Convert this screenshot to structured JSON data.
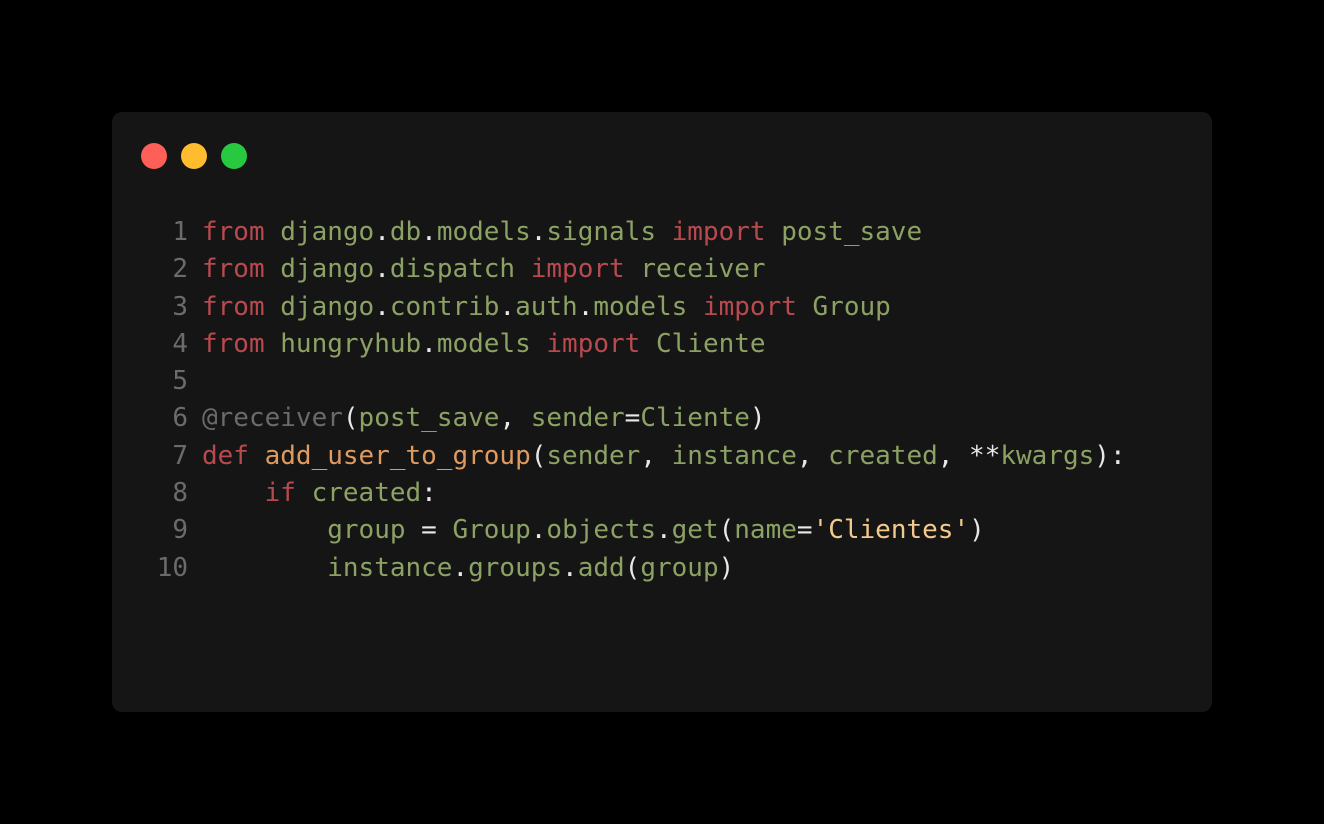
{
  "window": {
    "controls": [
      {
        "name": "close",
        "color": "#fe5f57"
      },
      {
        "name": "minimize",
        "color": "#febc2e"
      },
      {
        "name": "maximize",
        "color": "#28c840"
      }
    ]
  },
  "colors": {
    "keyword": "#b84a4f",
    "identifier": "#8ba264",
    "function": "#df9a5f",
    "string": "#f4c98c",
    "decorator": "#6a6a6a",
    "punctuation": "#e8e8e8",
    "line_number": "#6b6b6b",
    "background": "#151515"
  },
  "code": {
    "lines": [
      {
        "number": "1",
        "tokens": [
          {
            "t": "from",
            "k": "kw"
          },
          {
            "t": " ",
            "k": "op"
          },
          {
            "t": "django",
            "k": "id"
          },
          {
            "t": ".",
            "k": "op"
          },
          {
            "t": "db",
            "k": "id"
          },
          {
            "t": ".",
            "k": "op"
          },
          {
            "t": "models",
            "k": "id"
          },
          {
            "t": ".",
            "k": "op"
          },
          {
            "t": "signals",
            "k": "id"
          },
          {
            "t": " ",
            "k": "op"
          },
          {
            "t": "import",
            "k": "kw"
          },
          {
            "t": " ",
            "k": "op"
          },
          {
            "t": "post_save",
            "k": "id"
          }
        ]
      },
      {
        "number": "2",
        "tokens": [
          {
            "t": "from",
            "k": "kw"
          },
          {
            "t": " ",
            "k": "op"
          },
          {
            "t": "django",
            "k": "id"
          },
          {
            "t": ".",
            "k": "op"
          },
          {
            "t": "dispatch",
            "k": "id"
          },
          {
            "t": " ",
            "k": "op"
          },
          {
            "t": "import",
            "k": "kw"
          },
          {
            "t": " ",
            "k": "op"
          },
          {
            "t": "receiver",
            "k": "id"
          }
        ]
      },
      {
        "number": "3",
        "tokens": [
          {
            "t": "from",
            "k": "kw"
          },
          {
            "t": " ",
            "k": "op"
          },
          {
            "t": "django",
            "k": "id"
          },
          {
            "t": ".",
            "k": "op"
          },
          {
            "t": "contrib",
            "k": "id"
          },
          {
            "t": ".",
            "k": "op"
          },
          {
            "t": "auth",
            "k": "id"
          },
          {
            "t": ".",
            "k": "op"
          },
          {
            "t": "models",
            "k": "id"
          },
          {
            "t": " ",
            "k": "op"
          },
          {
            "t": "import",
            "k": "kw"
          },
          {
            "t": " ",
            "k": "op"
          },
          {
            "t": "Group",
            "k": "id"
          }
        ]
      },
      {
        "number": "4",
        "tokens": [
          {
            "t": "from",
            "k": "kw"
          },
          {
            "t": " ",
            "k": "op"
          },
          {
            "t": "hungryhub",
            "k": "id"
          },
          {
            "t": ".",
            "k": "op"
          },
          {
            "t": "models",
            "k": "id"
          },
          {
            "t": " ",
            "k": "op"
          },
          {
            "t": "import",
            "k": "kw"
          },
          {
            "t": " ",
            "k": "op"
          },
          {
            "t": "Cliente",
            "k": "id"
          }
        ]
      },
      {
        "number": "5",
        "tokens": []
      },
      {
        "number": "6",
        "tokens": [
          {
            "t": "@receiver",
            "k": "dec"
          },
          {
            "t": "(",
            "k": "op"
          },
          {
            "t": "post_save",
            "k": "id"
          },
          {
            "t": ", ",
            "k": "op"
          },
          {
            "t": "sender",
            "k": "id"
          },
          {
            "t": "=",
            "k": "op"
          },
          {
            "t": "Cliente",
            "k": "id"
          },
          {
            "t": ")",
            "k": "op"
          }
        ]
      },
      {
        "number": "7",
        "tokens": [
          {
            "t": "def",
            "k": "kw"
          },
          {
            "t": " ",
            "k": "op"
          },
          {
            "t": "add_user_to_group",
            "k": "fn"
          },
          {
            "t": "(",
            "k": "op"
          },
          {
            "t": "sender",
            "k": "id"
          },
          {
            "t": ", ",
            "k": "op"
          },
          {
            "t": "instance",
            "k": "id"
          },
          {
            "t": ", ",
            "k": "op"
          },
          {
            "t": "created",
            "k": "id"
          },
          {
            "t": ", **",
            "k": "op"
          },
          {
            "t": "kwargs",
            "k": "id"
          },
          {
            "t": "):",
            "k": "op"
          }
        ]
      },
      {
        "number": "8",
        "tokens": [
          {
            "t": "    ",
            "k": "op"
          },
          {
            "t": "if",
            "k": "kw"
          },
          {
            "t": " ",
            "k": "op"
          },
          {
            "t": "created",
            "k": "id"
          },
          {
            "t": ":",
            "k": "op"
          }
        ]
      },
      {
        "number": "9",
        "tokens": [
          {
            "t": "        ",
            "k": "op"
          },
          {
            "t": "group",
            "k": "id"
          },
          {
            "t": " = ",
            "k": "op"
          },
          {
            "t": "Group",
            "k": "id"
          },
          {
            "t": ".",
            "k": "op"
          },
          {
            "t": "objects",
            "k": "id"
          },
          {
            "t": ".",
            "k": "op"
          },
          {
            "t": "get",
            "k": "id"
          },
          {
            "t": "(",
            "k": "op"
          },
          {
            "t": "name",
            "k": "id"
          },
          {
            "t": "=",
            "k": "op"
          },
          {
            "t": "'Clientes'",
            "k": "str"
          },
          {
            "t": ")",
            "k": "op"
          }
        ]
      },
      {
        "number": "10",
        "tokens": [
          {
            "t": "        ",
            "k": "op"
          },
          {
            "t": "instance",
            "k": "id"
          },
          {
            "t": ".",
            "k": "op"
          },
          {
            "t": "groups",
            "k": "id"
          },
          {
            "t": ".",
            "k": "op"
          },
          {
            "t": "add",
            "k": "id"
          },
          {
            "t": "(",
            "k": "op"
          },
          {
            "t": "group",
            "k": "id"
          },
          {
            "t": ")",
            "k": "op"
          }
        ]
      }
    ]
  }
}
